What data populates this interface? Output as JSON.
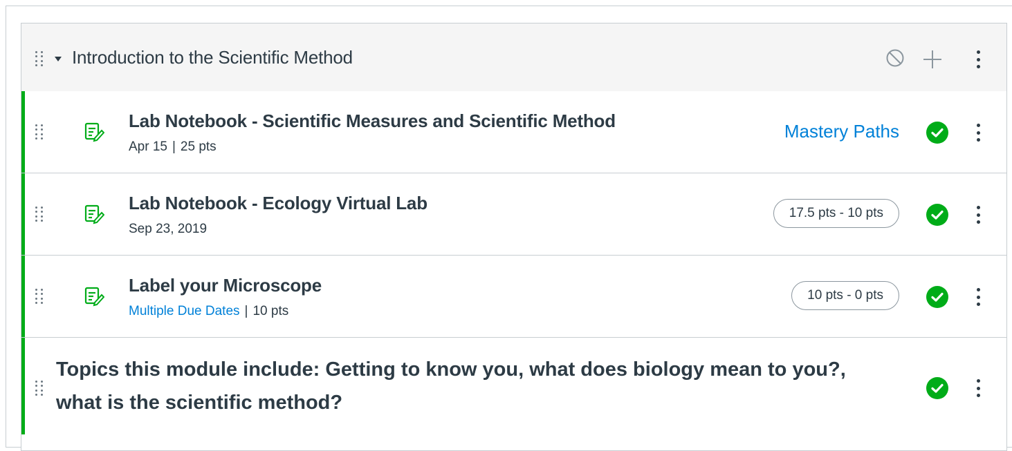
{
  "module": {
    "title": "Introduction to the Scientific Method"
  },
  "items": [
    {
      "title": "Lab Notebook - Scientific Measures and Scientific Method",
      "date": "Apr 15",
      "points": "25 pts",
      "mastery_link": "Mastery Paths"
    },
    {
      "title": "Lab Notebook - Ecology Virtual Lab",
      "date": "Sep 23, 2019",
      "range": "17.5 pts - 10 pts"
    },
    {
      "title": "Label your Microscope",
      "due_link": "Multiple Due Dates",
      "points": "10 pts",
      "range": "10 pts - 0 pts"
    }
  ],
  "subheader": {
    "text": "Topics this module include: Getting to know you, what does biology mean to you?, what is the scientific method?"
  },
  "meta": {
    "separator": "|"
  },
  "icons": {
    "drag": "drag-handle-icon",
    "collapse": "caret-down-icon",
    "unpublish": "no-entry-icon",
    "add": "plus-icon",
    "menu": "kebab-menu-icon",
    "assignment": "assignment-icon",
    "published": "check-circle-icon"
  },
  "colors": {
    "accent_green": "#00ac18",
    "link_blue": "#0081d8",
    "text": "#2d3b45",
    "header_bg": "#f5f5f5"
  }
}
